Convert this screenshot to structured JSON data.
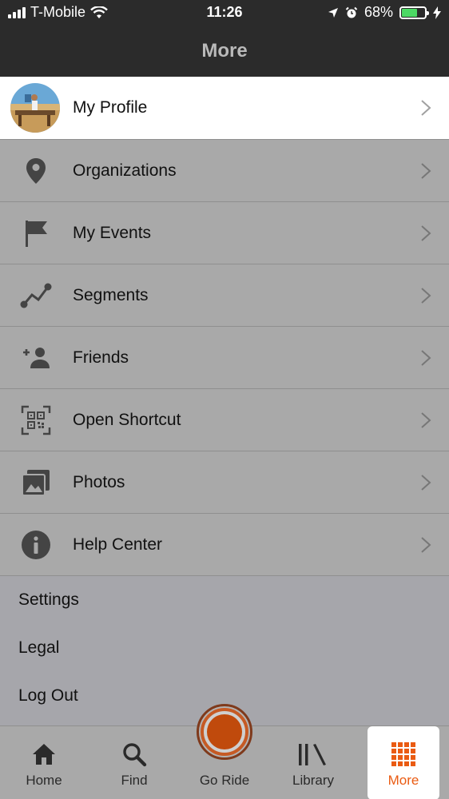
{
  "status_bar": {
    "carrier": "T-Mobile",
    "time": "11:26",
    "battery": "68%",
    "battery_level": 0.68
  },
  "header": {
    "title": "More"
  },
  "profile": {
    "label": "My Profile"
  },
  "menu": {
    "items": [
      {
        "label": "Organizations",
        "icon": "location-pin-icon"
      },
      {
        "label": "My Events",
        "icon": "flag-icon"
      },
      {
        "label": "Segments",
        "icon": "segment-line-icon"
      },
      {
        "label": "Friends",
        "icon": "add-friend-icon"
      },
      {
        "label": "Open Shortcut",
        "icon": "qr-code-icon"
      },
      {
        "label": "Photos",
        "icon": "photos-icon"
      },
      {
        "label": "Help Center",
        "icon": "info-icon"
      }
    ]
  },
  "secondary": {
    "settings": "Settings",
    "legal": "Legal",
    "logout": "Log Out"
  },
  "tabs": {
    "home": "Home",
    "find": "Find",
    "go_ride": "Go Ride",
    "library": "Library",
    "more": "More"
  },
  "colors": {
    "accent": "#EA5B12",
    "header_bg": "#2B2B2B",
    "battery_green": "#4CD964"
  }
}
